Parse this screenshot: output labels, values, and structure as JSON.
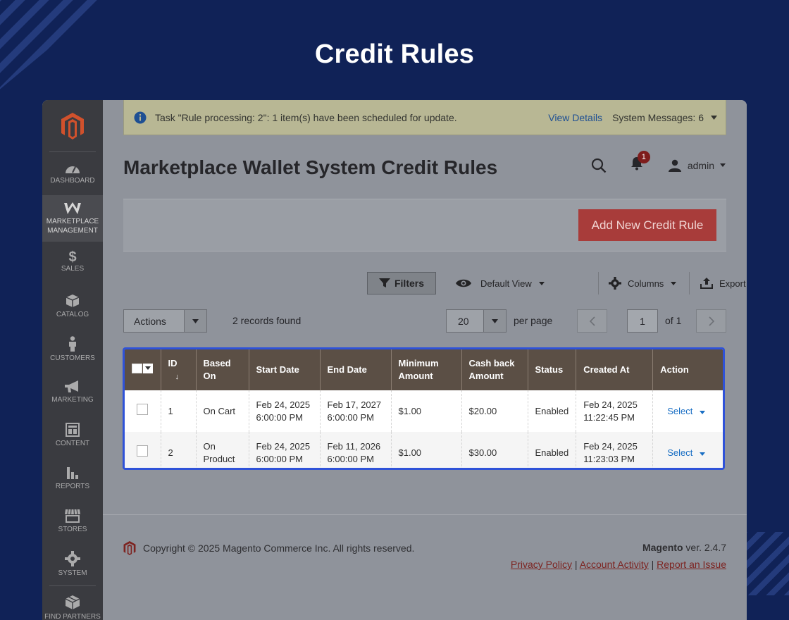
{
  "hero": {
    "title": "Credit Rules"
  },
  "colors": {
    "background": "#102257",
    "accent": "#a83c3a",
    "grid_header": "#5b4f45",
    "highlight": "#2f52d8"
  },
  "sidebar": {
    "items": [
      {
        "label": "Dashboard",
        "icon": "dashboard-icon"
      },
      {
        "label": "Marketplace Management",
        "icon": "marketplace-w-icon"
      },
      {
        "label": "Sales",
        "icon": "dollar-icon"
      },
      {
        "label": "Catalog",
        "icon": "box-icon"
      },
      {
        "label": "Customers",
        "icon": "person-icon"
      },
      {
        "label": "Marketing",
        "icon": "megaphone-icon"
      },
      {
        "label": "Content",
        "icon": "layout-icon"
      },
      {
        "label": "Reports",
        "icon": "bar-chart-icon"
      },
      {
        "label": "Stores",
        "icon": "storefront-icon"
      },
      {
        "label": "System",
        "icon": "gear-icon"
      },
      {
        "label": "Find Partners",
        "icon": "partners-box-icon"
      }
    ]
  },
  "system_message": {
    "text": "Task \"Rule processing: 2\": 1 item(s) have been scheduled for update.",
    "view_details": "View Details",
    "system_messages": "System Messages: 6"
  },
  "header": {
    "title": "Marketplace Wallet System Credit Rules",
    "notification_count": "1",
    "user": "admin"
  },
  "actions": {
    "add_new": "Add New Credit Rule"
  },
  "toolbar": {
    "filters": "Filters",
    "default_view": "Default View",
    "columns": "Columns",
    "export": "Export"
  },
  "grid_controls": {
    "mass_actions": "Actions",
    "records_found": "2 records found",
    "per_page_value": "20",
    "per_page_label": "per page",
    "page": "1",
    "of_pages": "of 1"
  },
  "grid": {
    "columns": {
      "id": "ID",
      "id_sort": "↓",
      "based_on": "Based On",
      "start_date": "Start Date",
      "end_date": "End Date",
      "minimum_amount": "Minimum Amount",
      "cash_back": "Cash back Amount",
      "status": "Status",
      "created_at": "Created At",
      "action": "Action"
    },
    "rows": [
      {
        "id": "1",
        "based_on": "On Cart",
        "start_date": "Feb 24, 2025",
        "start_time": "6:00:00 PM",
        "end_date": "Feb 17, 2027",
        "end_time": "6:00:00 PM",
        "minimum_amount": "$1.00",
        "cash_back": "$20.00",
        "status": "Enabled",
        "created_date": "Feb 24, 2025",
        "created_time": "11:22:45 PM",
        "action": "Select"
      },
      {
        "id": "2",
        "based_on": "On Product",
        "start_date": "Feb 24, 2025",
        "start_time": "6:00:00 PM",
        "end_date": "Feb 11, 2026",
        "end_time": "6:00:00 PM",
        "minimum_amount": "$1.00",
        "cash_back": "$30.00",
        "status": "Enabled",
        "created_date": "Feb 24, 2025",
        "created_time": "11:23:03 PM",
        "action": "Select"
      }
    ]
  },
  "footer": {
    "copyright": "Copyright © 2025 Magento Commerce Inc. All rights reserved.",
    "brand": "Magento",
    "version": "ver. 2.4.7",
    "links": [
      "Privacy Policy",
      "Account Activity",
      "Report an Issue"
    ],
    "separator": "|"
  }
}
